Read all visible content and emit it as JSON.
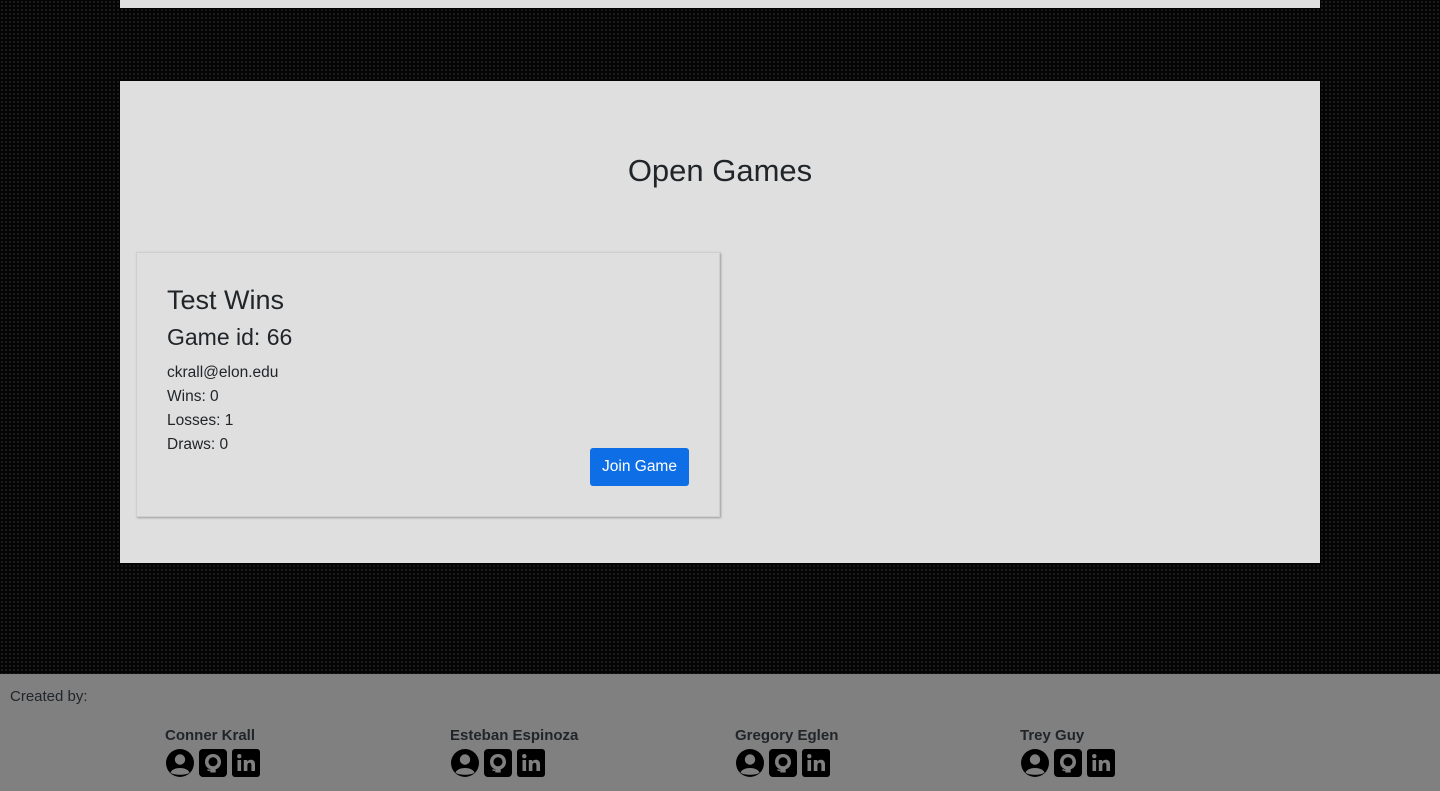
{
  "open_games": {
    "title": "Open Games",
    "games": [
      {
        "title": "Test Wins",
        "game_id": "Game id: 66",
        "email": "ckrall@elon.edu",
        "wins": "Wins: 0",
        "losses": "Losses: 1",
        "draws": "Draws: 0",
        "join_label": "Join Game"
      }
    ]
  },
  "footer": {
    "created_by": "Created by:",
    "creators": [
      {
        "name": "Conner Krall",
        "icons": [
          "user-icon",
          "github-icon",
          "linkedin-icon"
        ]
      },
      {
        "name": "Esteban Espinoza",
        "icons": [
          "user-icon",
          "github-icon",
          "linkedin-icon"
        ]
      },
      {
        "name": "Gregory Eglen",
        "icons": [
          "user-icon",
          "github-icon",
          "linkedin-icon"
        ]
      },
      {
        "name": "Trey Guy",
        "icons": [
          "user-icon",
          "github-icon",
          "linkedin-icon"
        ]
      }
    ]
  },
  "colors": {
    "panel_bg": "#dfdfdf",
    "button_primary": "#0d6ee6",
    "footer_bg": "#808080",
    "page_bg": "#050505"
  }
}
